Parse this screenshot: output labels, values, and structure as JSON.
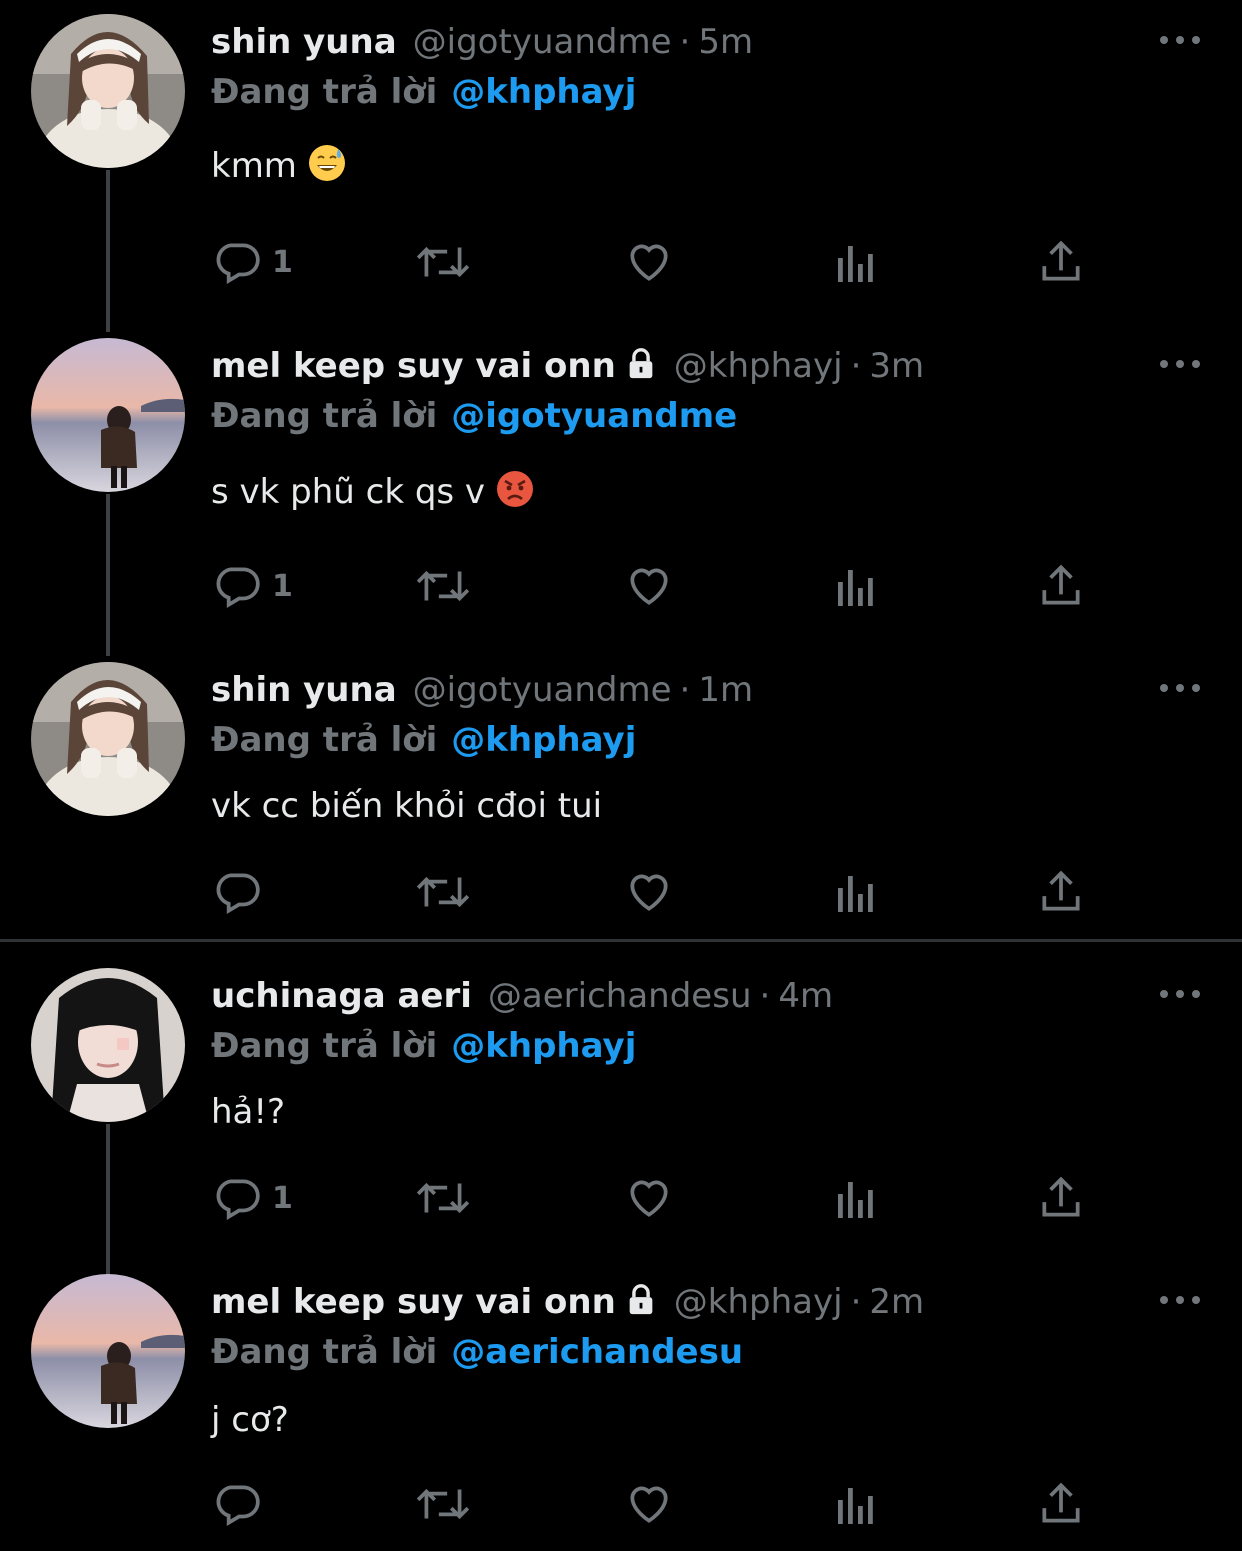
{
  "tweets": [
    {
      "display_name": "shin yuna",
      "handle": "@igotyuandme",
      "separator": "·",
      "time": "5m",
      "locked": false,
      "reply_label": "Đang trả lời",
      "reply_to": "@khphayj",
      "text": "kmm",
      "emoji": "sweat-smile",
      "reply_count": "1",
      "avatar": "avatar-yuna"
    },
    {
      "display_name": "mel keep suy vai onn",
      "handle": "@khphayj",
      "separator": "·",
      "time": "3m",
      "locked": true,
      "reply_label": "Đang trả lời",
      "reply_to": "@igotyuandme",
      "text": "s vk phũ ck qs v",
      "emoji": "angry-face",
      "reply_count": "1",
      "avatar": "avatar-mel"
    },
    {
      "display_name": "shin yuna",
      "handle": "@igotyuandme",
      "separator": "·",
      "time": "1m",
      "locked": false,
      "reply_label": "Đang trả lời",
      "reply_to": "@khphayj",
      "text": "vk cc biến khỏi cđoi tui",
      "emoji": "",
      "reply_count": "",
      "avatar": "avatar-yuna"
    },
    {
      "display_name": "uchinaga aeri",
      "handle": "@aerichandesu",
      "separator": "·",
      "time": "4m",
      "locked": false,
      "reply_label": "Đang trả lời",
      "reply_to": "@khphayj",
      "text": "hả!?",
      "emoji": "",
      "reply_count": "1",
      "avatar": "avatar-aeri"
    },
    {
      "display_name": "mel keep suy vai onn",
      "handle": "@khphayj",
      "separator": "·",
      "time": "2m",
      "locked": true,
      "reply_label": "Đang trả lời",
      "reply_to": "@aerichandesu",
      "text": "j cơ?",
      "emoji": "",
      "reply_count": "",
      "avatar": "avatar-mel"
    }
  ],
  "icons": {
    "reply": "reply-icon",
    "retweet": "retweet-icon",
    "like": "heart-icon",
    "views": "views-icon",
    "share": "share-icon",
    "more": "more-icon",
    "lock": "lock-icon"
  },
  "colors": {
    "background": "#000000",
    "primary_text": "#e7e9ea",
    "secondary_text": "#71767b",
    "mention": "#1d9bf0",
    "thread_line": "#3e4144"
  }
}
